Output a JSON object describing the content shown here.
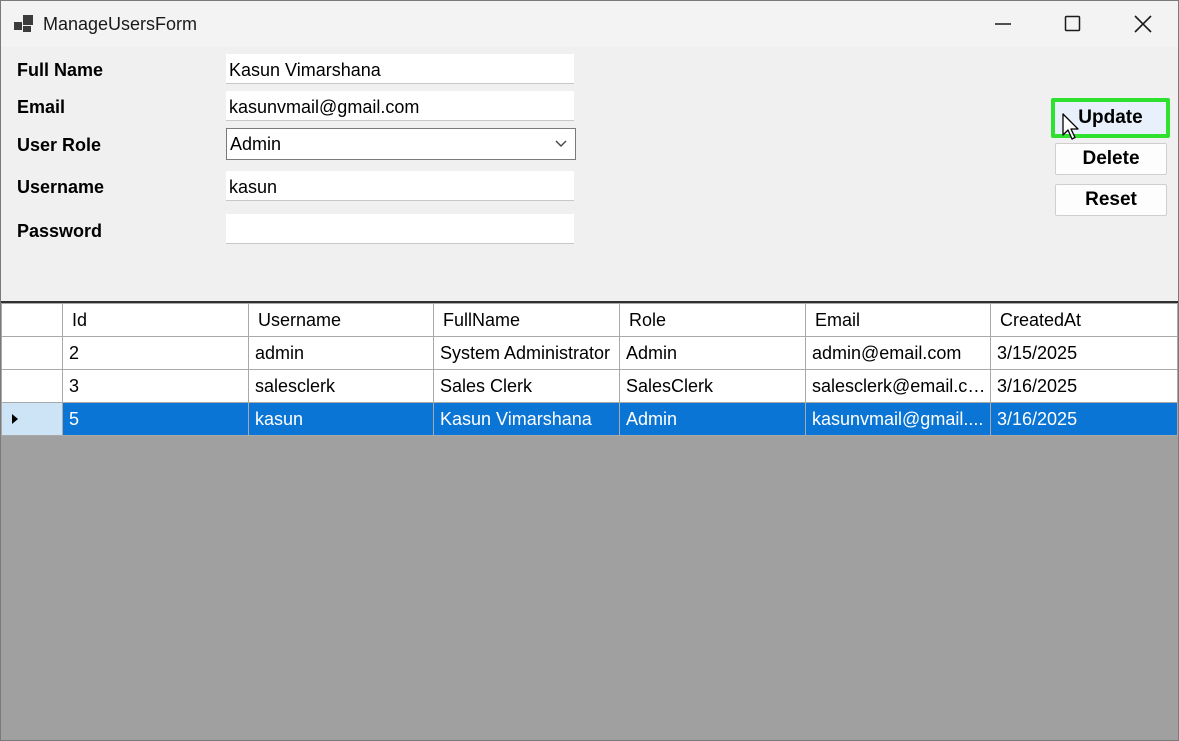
{
  "window": {
    "title": "ManageUsersForm",
    "controls": [
      "minimize-icon",
      "maximize-icon",
      "close-icon"
    ]
  },
  "form": {
    "full_name_label": "Full Name",
    "full_name_value": "Kasun Vimarshana",
    "email_label": "Email",
    "email_value": "kasunvmail@gmail.com",
    "role_label": "User Role",
    "role_value": "Admin",
    "username_label": "Username",
    "username_value": "kasun",
    "password_label": "Password",
    "password_value": ""
  },
  "buttons": {
    "update": "Update",
    "delete": "Delete",
    "reset": "Reset"
  },
  "grid": {
    "columns": [
      "Id",
      "Username",
      "FullName",
      "Role",
      "Email",
      "CreatedAt"
    ],
    "rows": [
      {
        "id": "2",
        "username": "admin",
        "fullname": "System Administrator",
        "role": "Admin",
        "email": "admin@email.com",
        "created": "3/15/2025"
      },
      {
        "id": "3",
        "username": "salesclerk",
        "fullname": "Sales Clerk",
        "role": "SalesClerk",
        "email": "salesclerk@email.com",
        "created": "3/16/2025"
      },
      {
        "id": "5",
        "username": "kasun",
        "fullname": "Kasun Vimarshana",
        "role": "Admin",
        "email": "kasunvmail@gmail....",
        "created": "3/16/2025"
      }
    ],
    "selected_row_index": 2
  },
  "colors": {
    "selection": "#0a75d5",
    "focus_highlight": "#2ee12e",
    "grid_background": "#a0a0a0"
  }
}
